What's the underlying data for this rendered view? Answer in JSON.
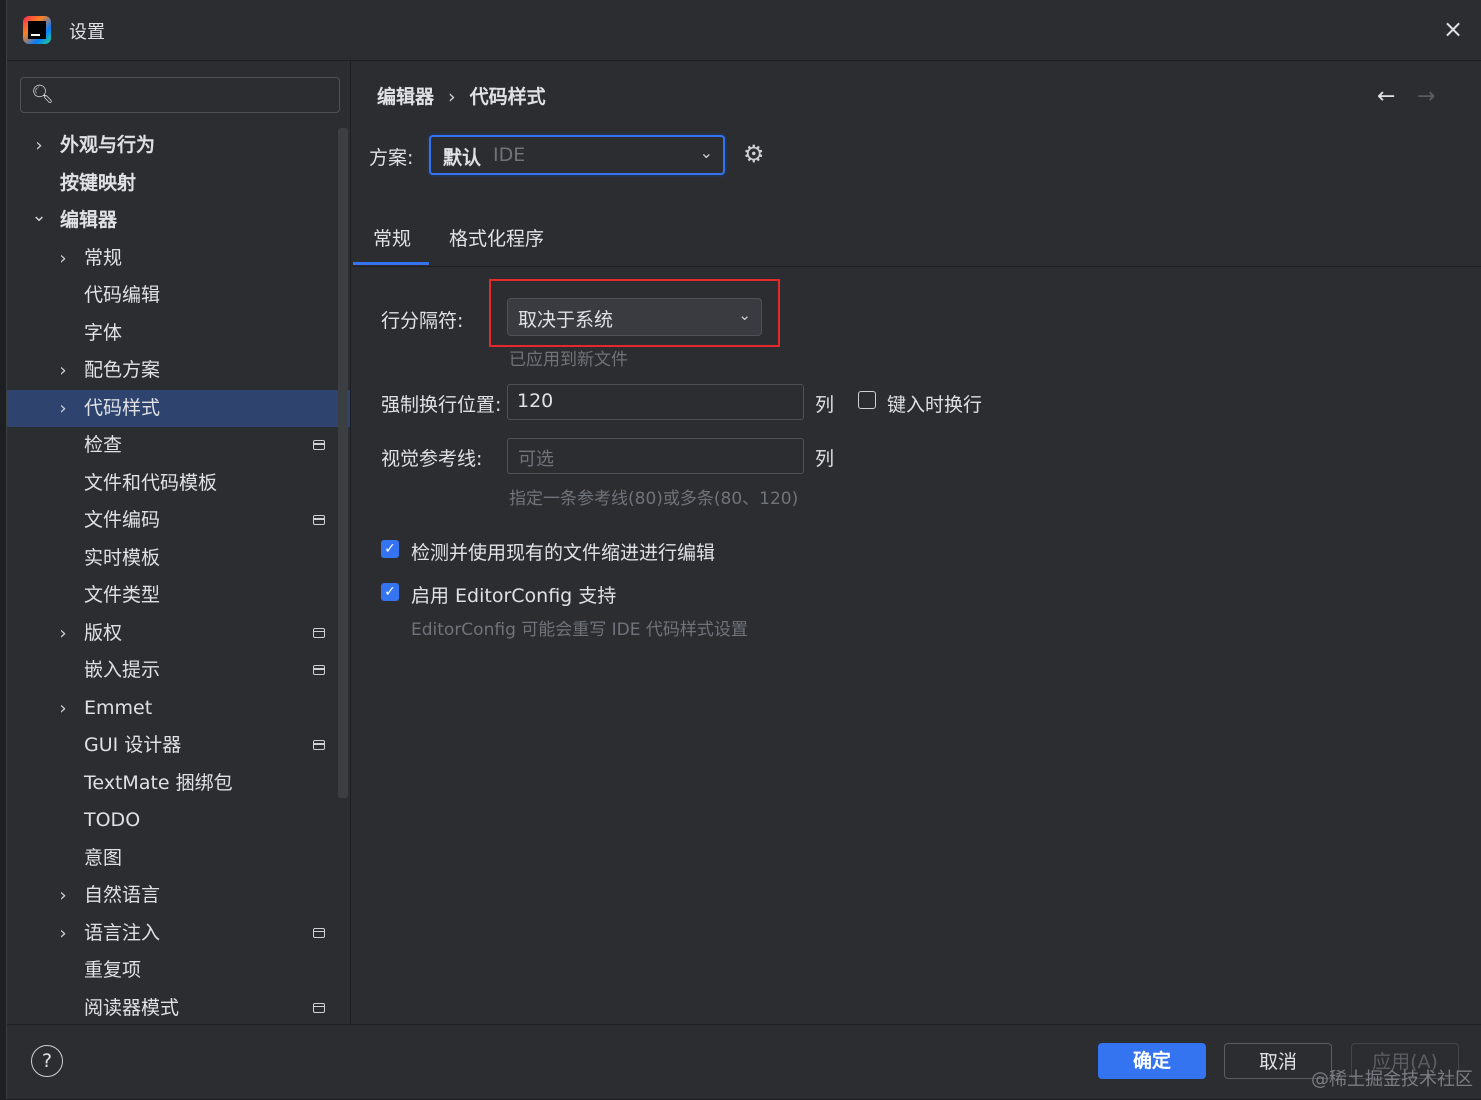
{
  "window": {
    "title": "设置",
    "close_icon": "×"
  },
  "search": {
    "value": ""
  },
  "tree": [
    {
      "label": "外观与行为",
      "level": 0,
      "chevron": "›",
      "bold": true,
      "pin": false
    },
    {
      "label": "按键映射",
      "level": 0,
      "chevron": "",
      "bold": true,
      "pin": false
    },
    {
      "label": "编辑器",
      "level": 0,
      "chevron": "⌄",
      "bold": true,
      "pin": false
    },
    {
      "label": "常规",
      "level": 1,
      "chevron": "›",
      "bold": false,
      "pin": false
    },
    {
      "label": "代码编辑",
      "level": 1,
      "chevron": "",
      "bold": false,
      "pin": false
    },
    {
      "label": "字体",
      "level": 1,
      "chevron": "",
      "bold": false,
      "pin": false
    },
    {
      "label": "配色方案",
      "level": 1,
      "chevron": "›",
      "bold": false,
      "pin": false
    },
    {
      "label": "代码样式",
      "level": 1,
      "chevron": "›",
      "bold": false,
      "pin": false,
      "selected": true
    },
    {
      "label": "检查",
      "level": 1,
      "chevron": "",
      "bold": false,
      "pin": true
    },
    {
      "label": "文件和代码模板",
      "level": 1,
      "chevron": "",
      "bold": false,
      "pin": false
    },
    {
      "label": "文件编码",
      "level": 1,
      "chevron": "",
      "bold": false,
      "pin": true
    },
    {
      "label": "实时模板",
      "level": 1,
      "chevron": "",
      "bold": false,
      "pin": false
    },
    {
      "label": "文件类型",
      "level": 1,
      "chevron": "",
      "bold": false,
      "pin": false
    },
    {
      "label": "版权",
      "level": 1,
      "chevron": "›",
      "bold": false,
      "pin": true
    },
    {
      "label": "嵌入提示",
      "level": 1,
      "chevron": "",
      "bold": false,
      "pin": true
    },
    {
      "label": "Emmet",
      "level": 1,
      "chevron": "›",
      "bold": false,
      "pin": false
    },
    {
      "label": "GUI 设计器",
      "level": 1,
      "chevron": "",
      "bold": false,
      "pin": true
    },
    {
      "label": "TextMate 捆绑包",
      "level": 1,
      "chevron": "",
      "bold": false,
      "pin": false
    },
    {
      "label": "TODO",
      "level": 1,
      "chevron": "",
      "bold": false,
      "pin": false
    },
    {
      "label": "意图",
      "level": 1,
      "chevron": "",
      "bold": false,
      "pin": false
    },
    {
      "label": "自然语言",
      "level": 1,
      "chevron": "›",
      "bold": false,
      "pin": false
    },
    {
      "label": "语言注入",
      "level": 1,
      "chevron": "›",
      "bold": false,
      "pin": true
    },
    {
      "label": "重复项",
      "level": 1,
      "chevron": "",
      "bold": false,
      "pin": false
    },
    {
      "label": "阅读器模式",
      "level": 1,
      "chevron": "",
      "bold": false,
      "pin": true
    }
  ],
  "breadcrumb": {
    "parent": "编辑器",
    "separator": "›",
    "current": "代码样式"
  },
  "nav": {
    "back": "←",
    "forward": "→"
  },
  "scheme": {
    "label": "方案:",
    "value_bold": "默认",
    "value_suffix": "IDE"
  },
  "tabs": [
    {
      "label": "常规",
      "active": true
    },
    {
      "label": "格式化程序",
      "active": false
    }
  ],
  "line_separator": {
    "label": "行分隔符:",
    "value": "取决于系统",
    "hint": "已应用到新文件"
  },
  "hard_wrap": {
    "label": "强制换行位置:",
    "value": "120",
    "unit": "列",
    "wrap_on_typing_label": "键入时换行",
    "wrap_on_typing": false
  },
  "visual_guides": {
    "label": "视觉参考线:",
    "placeholder": "可选",
    "unit": "列",
    "hint": "指定一条参考线(80)或多条(80、120)"
  },
  "detect_indent": {
    "label": "检测并使用现有的文件缩进进行编辑",
    "checked": true
  },
  "editorconfig": {
    "label": "启用 EditorConfig 支持",
    "checked": true,
    "hint": "EditorConfig 可能会重写 IDE 代码样式设置"
  },
  "footer": {
    "help": "?",
    "ok": "确定",
    "cancel": "取消",
    "apply": "应用(A)"
  },
  "watermark": "@稀土掘金技术社区",
  "colors": {
    "accent": "#3574f0",
    "highlight_border": "#e5292a",
    "selection": "#2e436e"
  }
}
